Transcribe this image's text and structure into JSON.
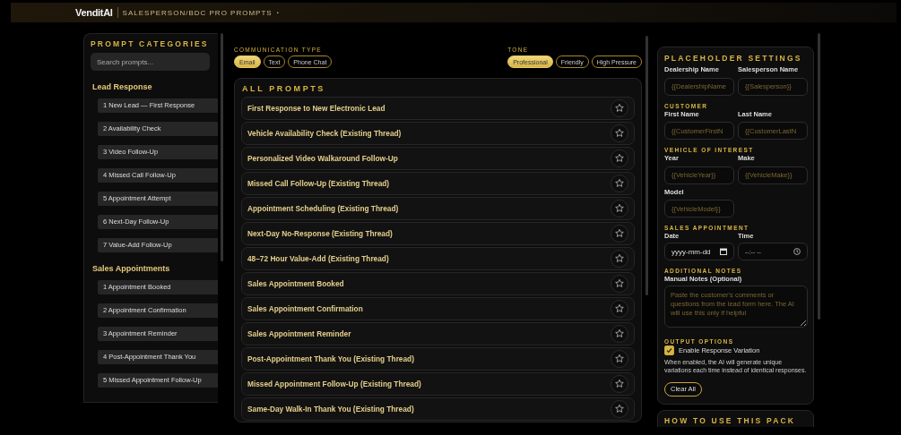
{
  "header": {
    "brand": "VenditAI",
    "title": "SALESPERSON/BDC PRO PROMPTS",
    "dot": "•"
  },
  "sidebar": {
    "title": "PROMPT CATEGORIES",
    "search": {
      "placeholder": "Search prompts..."
    },
    "groups": [
      {
        "name": "Lead Response",
        "items": [
          "1 New Lead — First Response",
          "2 Availability Check",
          "3 Video Follow-Up",
          "4 Missed Call Follow-Up",
          "5 Appointment Attempt",
          "6 Next-Day Follow-Up",
          "7 Value-Add Follow-Up"
        ]
      },
      {
        "name": "Sales Appointments",
        "items": [
          "1 Appointment Booked",
          "2 Appointment Confirmation",
          "3 Appointment Reminder",
          "4 Post-Appointment Thank You",
          "5 Missed Appointment Follow-Up"
        ]
      }
    ]
  },
  "communication_type": {
    "label": "COMMUNICATION TYPE",
    "options": [
      {
        "label": "Email",
        "selected": true
      },
      {
        "label": "Text",
        "selected": false
      },
      {
        "label": "Phone Chat",
        "selected": false
      }
    ]
  },
  "tone": {
    "label": "TONE",
    "options": [
      {
        "label": "Professional",
        "selected": true
      },
      {
        "label": "Friendly",
        "selected": false
      },
      {
        "label": "High Pressure",
        "selected": false
      }
    ]
  },
  "prompts": {
    "title": "ALL PROMPTS",
    "items": [
      "First Response to New Electronic Lead",
      "Vehicle Availability Check (Existing Thread)",
      "Personalized Video Walkaround Follow-Up",
      "Missed Call Follow-Up (Existing Thread)",
      "Appointment Scheduling (Existing Thread)",
      "Next-Day No-Response (Existing Thread)",
      "48–72 Hour Value-Add (Existing Thread)",
      "Sales Appointment Booked",
      "Sales Appointment Confirmation",
      "Sales Appointment Reminder",
      "Post-Appointment Thank You (Existing Thread)",
      "Missed Appointment Follow-Up (Existing Thread)",
      "Same-Day Walk-In Thank You (Existing Thread)"
    ]
  },
  "settings": {
    "title": "PLACEHOLDER SETTINGS",
    "sections": [
      {
        "fields": [
          {
            "kind": "text",
            "label": "Dealership Name",
            "placeholder": "{{DealershipName"
          },
          {
            "kind": "text",
            "label": "Salesperson Name",
            "placeholder": "{{Salesperson}}"
          }
        ]
      },
      {
        "heading": "CUSTOMER",
        "fields": [
          {
            "kind": "text",
            "label": "First Name",
            "placeholder": "{{CustomerFirstN"
          },
          {
            "kind": "text",
            "label": "Last Name",
            "placeholder": "{{CustomerLastN"
          }
        ]
      },
      {
        "heading": "VEHICLE OF INTEREST",
        "fields": [
          {
            "kind": "text",
            "label": "Year",
            "placeholder": "{{VehicleYear}}"
          },
          {
            "kind": "text",
            "label": "Make",
            "placeholder": "{{VehicleMake}}"
          },
          {
            "kind": "text",
            "label": "Model",
            "placeholder": "{{VehicleModel}}"
          }
        ]
      },
      {
        "heading": "SALES APPOINTMENT",
        "fields": [
          {
            "kind": "date",
            "label": "Date",
            "value": "yyyy-mm-dd"
          },
          {
            "kind": "time",
            "label": "Time",
            "value": "--:-- --"
          }
        ]
      },
      {
        "heading": "ADDITIONAL NOTES",
        "fields": [
          {
            "kind": "textarea",
            "label": "Manual Notes (Optional)",
            "placeholder": "Paste the customer's comments or questions from the lead form here. The AI will use this only if helpful"
          }
        ]
      }
    ],
    "output_options": {
      "heading": "OUTPUT OPTIONS",
      "checkbox": {
        "label": "Enable Response Variation",
        "checked": true
      },
      "hint": "When enabled, the AI will generate unique variations each time instead of identical responses."
    },
    "clear_button": "Clear All"
  },
  "how_to": {
    "title": "HOW TO USE THIS PACK"
  }
}
